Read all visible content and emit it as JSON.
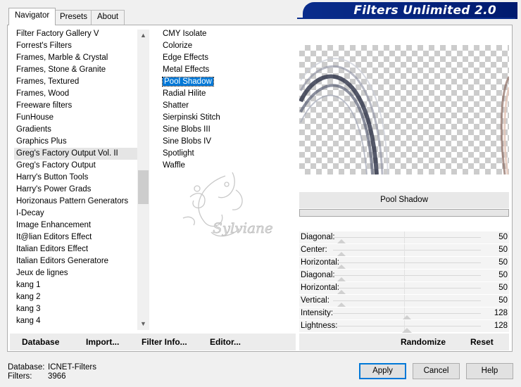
{
  "tabs": [
    "Navigator",
    "Presets",
    "About"
  ],
  "banner_title": "Filters Unlimited 2.0",
  "categories": [
    "Filter Factory Gallery V",
    "Forrest's Filters",
    "Frames, Marble & Crystal",
    "Frames, Stone & Granite",
    "Frames, Textured",
    "Frames, Wood",
    "Freeware filters",
    "FunHouse",
    "Gradients",
    "Graphics Plus",
    "Greg's Factory Output Vol. II",
    "Greg's Factory Output",
    "Harry's Button Tools",
    "Harry's Power Grads",
    "Horizonaus Pattern Generators",
    "I-Decay",
    "Image Enhancement",
    "It@lian Editors Effect",
    "Italian Editors Effect",
    "Italian Editors Generatore",
    "Jeux de lignes",
    "kang 1",
    "kang 2",
    "kang 3",
    "kang 4"
  ],
  "highlighted_category": "Greg's Factory Output Vol. II",
  "filters": [
    "CMY Isolate",
    "Colorize",
    "Edge Effects",
    "Metal Effects",
    "Pool Shadow",
    "Radial Hilite",
    "Shatter",
    "Sierpinski Stitch",
    "Sine Blobs III",
    "Sine Blobs IV",
    "Spotlight",
    "Waffle"
  ],
  "selected_filter": "Pool Shadow",
  "watermark_text": "Sylviane",
  "filter_title": "Pool Shadow",
  "params": [
    {
      "label": "Diagonal:",
      "value": "50",
      "fraction": 0.0
    },
    {
      "label": "Center:",
      "value": "50",
      "fraction": 0.0
    },
    {
      "label": "Horizontal:",
      "value": "50",
      "fraction": 0.0
    },
    {
      "label": "Diagonal:",
      "value": "50",
      "fraction": 0.0
    },
    {
      "label": "Horizontal:",
      "value": "50",
      "fraction": 0.0
    },
    {
      "label": "Vertical:",
      "value": "50",
      "fraction": 0.0
    },
    {
      "label": "Intensity:",
      "value": "128",
      "fraction": 0.5
    },
    {
      "label": "Lightness:",
      "value": "128",
      "fraction": 0.5
    }
  ],
  "bottom_buttons": {
    "database": "Database",
    "import": "Import...",
    "filter_info": "Filter Info...",
    "editor": "Editor..."
  },
  "right_buttons": {
    "randomize": "Randomize",
    "reset": "Reset"
  },
  "status": {
    "database_label": "Database:",
    "database_value": "ICNET-Filters",
    "filters_label": "Filters:",
    "filters_value": "3966"
  },
  "dialog_buttons": {
    "apply": "Apply",
    "cancel": "Cancel",
    "help": "Help"
  },
  "colors": {
    "banner": "#0a2d8c",
    "selection": "#0078d7"
  }
}
